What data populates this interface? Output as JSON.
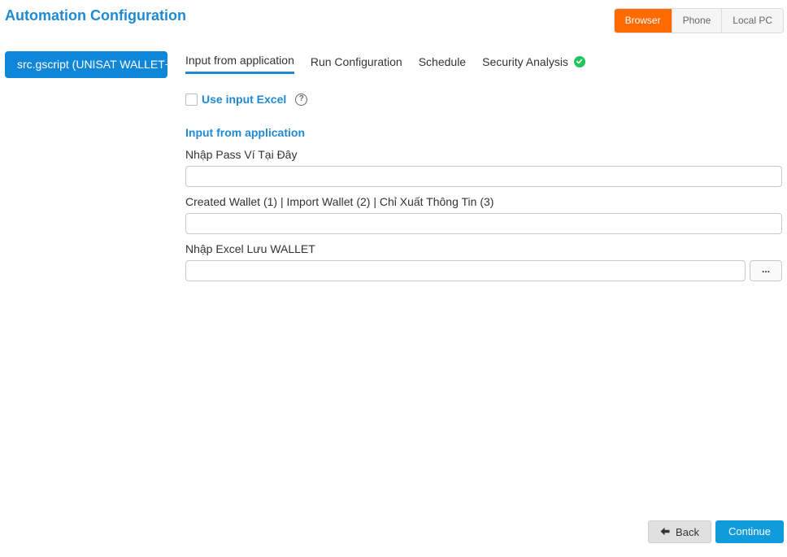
{
  "header": {
    "title": "Automation Configuration"
  },
  "platform": {
    "options": [
      {
        "label": "Browser",
        "active": true
      },
      {
        "label": "Phone",
        "active": false
      },
      {
        "label": "Local PC",
        "active": false
      }
    ],
    "active_color": "#ff6a00"
  },
  "sidebar": {
    "script_label": "src.gscript   (UNISAT WALLET+"
  },
  "tabs": [
    {
      "label": "Input from application",
      "active": true
    },
    {
      "label": "Run Configuration",
      "active": false
    },
    {
      "label": "Schedule",
      "active": false
    },
    {
      "label": "Security Analysis",
      "active": false,
      "status_icon": "check-circle-icon"
    }
  ],
  "excel_option": {
    "label": "Use input Excel",
    "checked": false,
    "help_icon": "question-circle-icon"
  },
  "form": {
    "section_title": "Input from application",
    "fields": [
      {
        "label": "Nhập Pass Ví Tại Đây",
        "value": ""
      },
      {
        "label": "Created Wallet (1) | Import Wallet (2) | Chỉ Xuất Thông Tin (3)",
        "value": ""
      },
      {
        "label": "Nhập Excel Lưu WALLET",
        "value": "",
        "browse_label": "..."
      }
    ]
  },
  "footer": {
    "back_label": "Back",
    "continue_label": "Continue"
  },
  "colors": {
    "accent": "#1f8ad4",
    "primary_button": "#119bdc",
    "success": "#22c55e"
  }
}
